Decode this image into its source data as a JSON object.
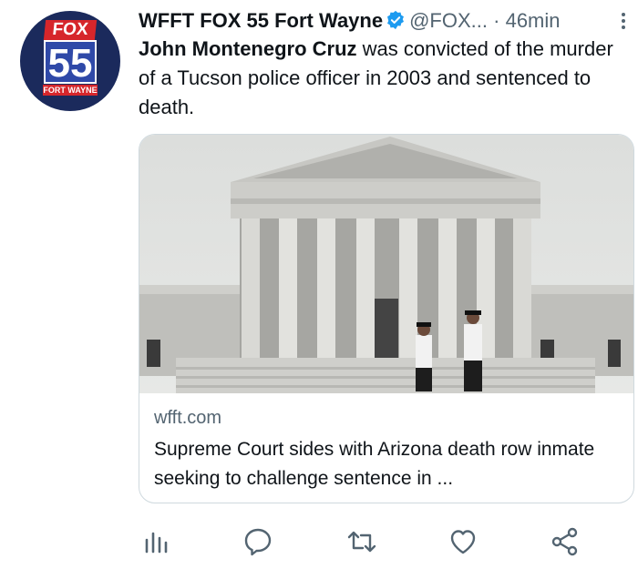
{
  "account": {
    "display_name": "WFFT FOX 55 Fort Wayne",
    "handle": "@FOX...",
    "separator": "·",
    "time": "46min",
    "avatar_logo": {
      "brand": "FOX",
      "channel": "55",
      "city": "FORT WAYNE"
    }
  },
  "tweet": {
    "bold_text": "John Montenegro Cruz",
    "text": " was convicted of the murder of a Tucson police officer in 2003 and sentenced to death."
  },
  "card": {
    "domain": "wfft.com",
    "headline": "Supreme Court sides with Arizona death row inmate seeking to challenge sentence in ..."
  },
  "actions": {
    "analytics_icon": "bar-chart",
    "reply_icon": "speech-bubble",
    "retweet_icon": "retweet-arrows",
    "like_icon": "heart",
    "share_icon": "share-nodes"
  },
  "colors": {
    "verified": "#1d9bf0",
    "icon": "#536471",
    "fox_red": "#d6262b",
    "fox_blue": "#1b2a5c"
  }
}
